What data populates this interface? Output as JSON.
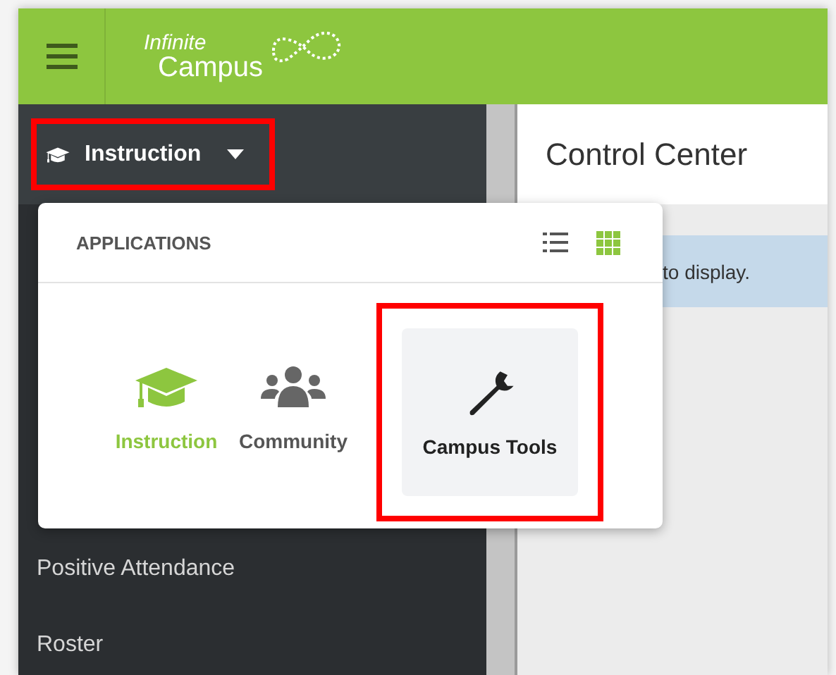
{
  "header": {
    "logo_top": "Infinite",
    "logo_bottom": "Campus"
  },
  "sidebar": {
    "app_switcher": {
      "label": "Instruction",
      "highlighted": true
    },
    "items": [
      {
        "label": "Positive Attendance"
      },
      {
        "label": "Roster"
      }
    ]
  },
  "main": {
    "title": "Control Center",
    "notice": "to display."
  },
  "popup": {
    "title": "APPLICATIONS",
    "views": [
      {
        "kind": "list",
        "selected": false
      },
      {
        "kind": "grid",
        "selected": true
      }
    ],
    "apps": [
      {
        "kind": "cap",
        "label": "Instruction",
        "selected": true,
        "highlighted": false
      },
      {
        "kind": "people",
        "label": "Community",
        "selected": false,
        "highlighted": false
      },
      {
        "kind": "wrench",
        "label": "Campus Tools",
        "selected": false,
        "highlighted": true
      }
    ]
  }
}
